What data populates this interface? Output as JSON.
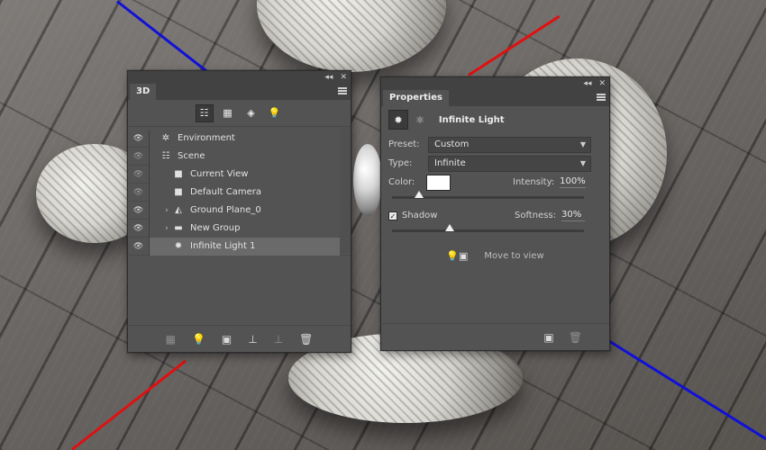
{
  "colors": {
    "axis_blue": "#1010d8",
    "axis_red": "#e01010",
    "panel_bg": "#535353",
    "panel_dark": "#424242",
    "selected_row": "#6a6a6a"
  },
  "panel3d": {
    "tab": "3D",
    "collapse_icon": "double-chevron-left-icon",
    "close_icon": "close-icon",
    "filters": [
      {
        "icon": "whole-scene-icon",
        "glyph": "☷"
      },
      {
        "icon": "meshes-icon",
        "glyph": "▦"
      },
      {
        "icon": "materials-icon",
        "glyph": "◈"
      },
      {
        "icon": "lights-icon",
        "glyph": "💡"
      }
    ],
    "layers": [
      {
        "name": "Environment",
        "icon": "environment-icon",
        "glyph": "✲",
        "indent": 0,
        "chevron": "",
        "eye": "bright",
        "selected": false
      },
      {
        "name": "Scene",
        "icon": "scene-icon",
        "glyph": "☷",
        "indent": 0,
        "chevron": "",
        "eye": "dim",
        "selected": false
      },
      {
        "name": "Current View",
        "icon": "camera-icon",
        "glyph": "■",
        "indent": 1,
        "chevron": "",
        "eye": "dim",
        "selected": false
      },
      {
        "name": "Default Camera",
        "icon": "camera-icon",
        "glyph": "■",
        "indent": 1,
        "chevron": "",
        "eye": "dim",
        "selected": false
      },
      {
        "name": "Ground Plane_0",
        "icon": "mesh-icon",
        "glyph": "◭",
        "indent": 1,
        "chevron": "›",
        "eye": "bright",
        "selected": false
      },
      {
        "name": "New Group",
        "icon": "folder-icon",
        "glyph": "▬",
        "indent": 1,
        "chevron": "›",
        "eye": "bright",
        "selected": false
      },
      {
        "name": "Infinite Light 1",
        "icon": "infinite-light-icon",
        "glyph": "✹",
        "indent": 1,
        "chevron": "",
        "eye": "bright",
        "selected": true
      }
    ],
    "footer": [
      {
        "icon": "add-mesh-icon",
        "glyph": "▦",
        "dim": true
      },
      {
        "icon": "add-light-icon",
        "glyph": "💡",
        "dim": false
      },
      {
        "icon": "add-constraint-icon",
        "glyph": "▣",
        "dim": false
      },
      {
        "icon": "drop-to-plane-icon",
        "glyph": "⊥",
        "dim": false
      },
      {
        "icon": "render-icon",
        "glyph": "⊥",
        "dim": true
      },
      {
        "icon": "trash-icon",
        "glyph": "🗑",
        "dim": false
      }
    ]
  },
  "properties": {
    "tab": "Properties",
    "header_title": "Infinite Light",
    "preset_label": "Preset:",
    "preset_value": "Custom",
    "type_label": "Type:",
    "type_value": "Infinite",
    "color_label": "Color:",
    "color_value": "#ffffff",
    "intensity_label": "Intensity:",
    "intensity_value": "100%",
    "intensity_slider": 0.14,
    "shadow_label": "Shadow",
    "shadow_checked": true,
    "softness_label": "Softness:",
    "softness_value": "30%",
    "softness_slider": 0.3,
    "move_to_view": "Move to view"
  }
}
